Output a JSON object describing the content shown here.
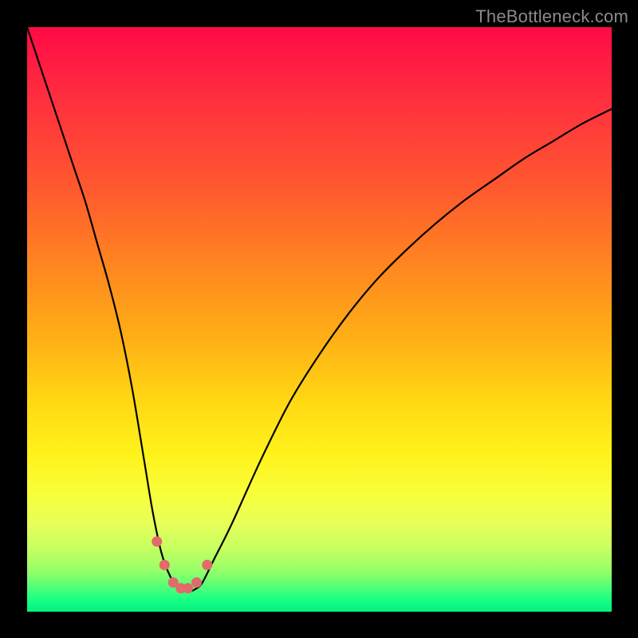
{
  "watermark": "TheBottleneck.com",
  "colors": {
    "frame": "#000000",
    "gradient_top": "#ff0a46",
    "gradient_bottom": "#05f07f",
    "curve": "#000000",
    "points": "#e16a6a"
  },
  "chart_data": {
    "type": "line",
    "title": "",
    "xlabel": "",
    "ylabel": "",
    "xlim": [
      0,
      100
    ],
    "ylim": [
      0,
      100
    ],
    "series": [
      {
        "name": "bottleneck-curve",
        "x": [
          0,
          2,
          4,
          6,
          8,
          10,
          12,
          14,
          16,
          18,
          20,
          21.5,
          23,
          24.5,
          26,
          27,
          28,
          29,
          30,
          32,
          35,
          40,
          45,
          50,
          55,
          60,
          65,
          70,
          75,
          80,
          85,
          90,
          95,
          100
        ],
        "y": [
          100,
          94,
          88,
          82,
          76,
          70,
          63,
          56,
          48,
          38,
          26,
          17,
          10,
          6,
          4,
          3.5,
          3.5,
          4,
          5,
          9,
          15,
          26,
          36,
          44,
          51,
          57,
          62,
          66.5,
          70.5,
          74,
          77.5,
          80.5,
          83.5,
          86
        ]
      }
    ],
    "markers": [
      {
        "x": 22.2,
        "y": 12
      },
      {
        "x": 23.5,
        "y": 8
      },
      {
        "x": 25.0,
        "y": 5
      },
      {
        "x": 26.3,
        "y": 4
      },
      {
        "x": 27.5,
        "y": 4
      },
      {
        "x": 29.0,
        "y": 5
      },
      {
        "x": 30.8,
        "y": 8
      }
    ],
    "annotations": []
  }
}
